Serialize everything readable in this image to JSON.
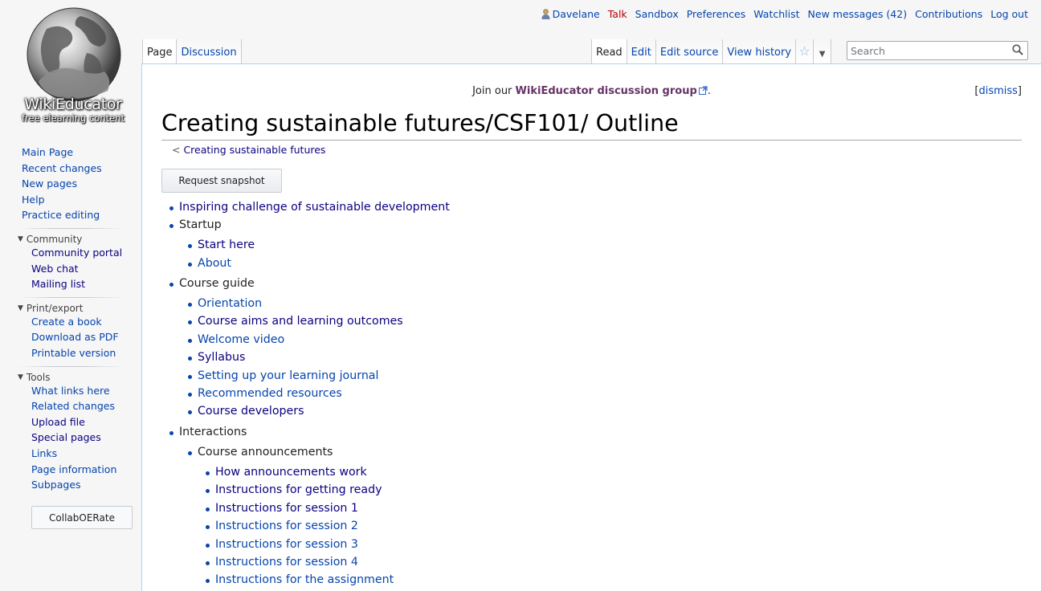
{
  "logo": {
    "title": "WikiEducator",
    "subtitle": "free elearning content"
  },
  "personal": {
    "username": "Davelane",
    "talk": "Talk",
    "sandbox": "Sandbox",
    "preferences": "Preferences",
    "watchlist": "Watchlist",
    "messages": "New messages (42)",
    "contributions": "Contributions",
    "logout": "Log out"
  },
  "tabs": {
    "page": "Page",
    "discussion": "Discussion",
    "read": "Read",
    "edit": "Edit",
    "edit_source": "Edit source",
    "view_history": "View history"
  },
  "search": {
    "placeholder": "Search",
    "value": ""
  },
  "sidebar": {
    "main": [
      "Main Page",
      "Recent changes",
      "New pages",
      "Help",
      "Practice editing"
    ],
    "community": {
      "title": "Community",
      "items": [
        "Community portal",
        "Web chat",
        "Mailing list"
      ]
    },
    "print": {
      "title": "Print/export",
      "items": [
        "Create a book",
        "Download as PDF",
        "Printable version"
      ]
    },
    "tools": {
      "title": "Tools",
      "items": [
        "What links here",
        "Related changes",
        "Upload file",
        "Special pages",
        "Links",
        "Page information",
        "Subpages"
      ]
    },
    "collab_button": "CollabOERate"
  },
  "notice": {
    "prefix": "Join our ",
    "link": "WikiEducator discussion group",
    "suffix": ".",
    "dismiss": "dismiss"
  },
  "page": {
    "title": "Creating sustainable futures/CSF101/ Outline",
    "breadcrumb_prefix": "< ",
    "breadcrumb": "Creating sustainable futures",
    "snapshot_button": "Request snapshot"
  },
  "outline": [
    "Inspiring challenge of sustainable development",
    "Startup",
    "Start here",
    "About",
    "Course guide",
    "Orientation",
    "Course aims and learning outcomes",
    "Welcome video",
    "Syllabus",
    "Setting up your learning journal",
    "Recommended resources",
    "Course developers",
    "Interactions",
    "Course announcements",
    "How announcements work",
    "Instructions for getting ready",
    "Instructions for session 1",
    "Instructions for session 2",
    "Instructions for session 3",
    "Instructions for session 4",
    "Instructions for the assignment"
  ],
  "colors": {
    "link": "#0645ad",
    "visited": "#0b0080",
    "new_link": "#ba0000",
    "external": "#663366"
  }
}
